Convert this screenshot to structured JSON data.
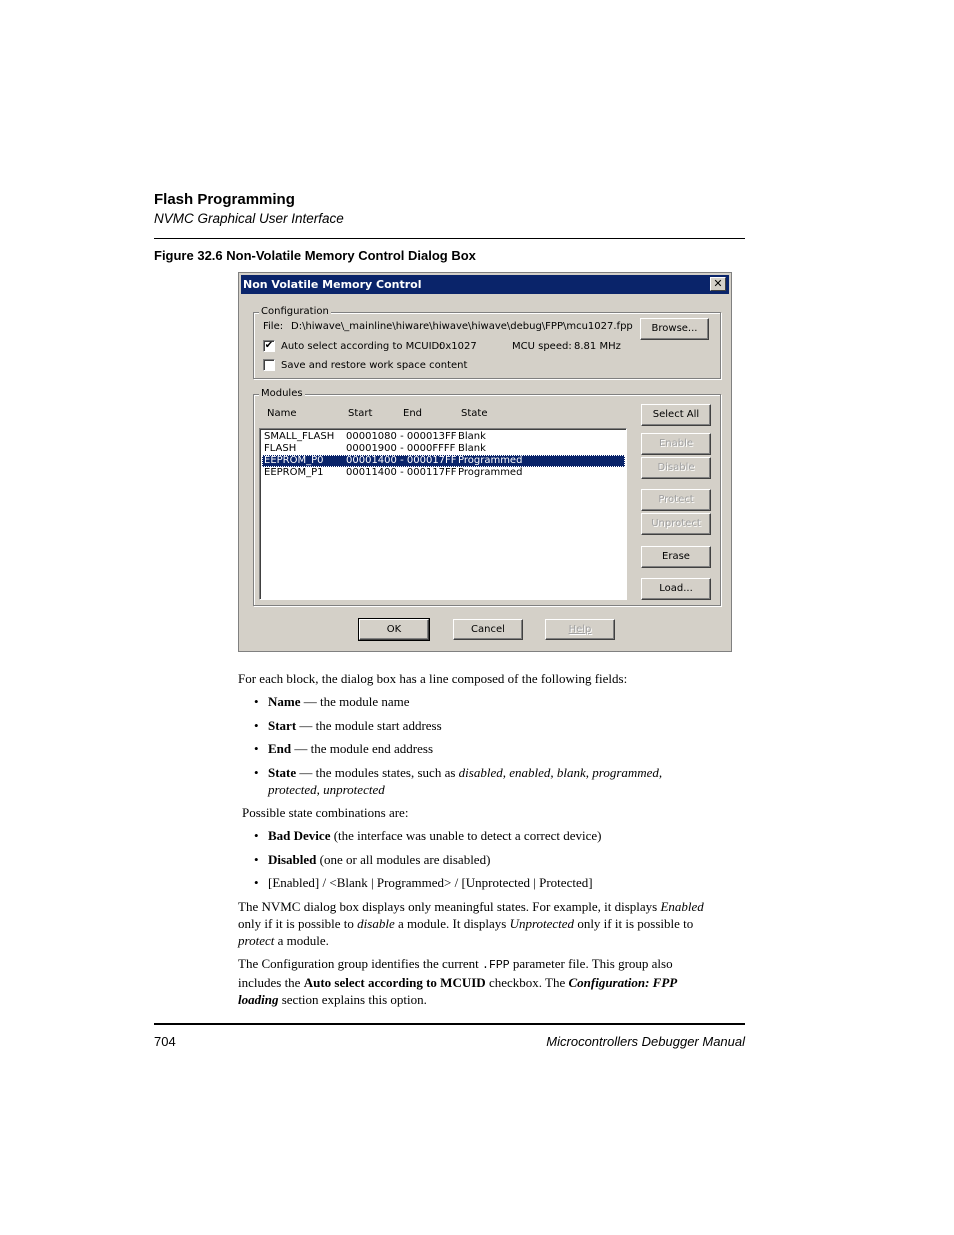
{
  "header": {
    "title": "Flash Programming",
    "subtitle": "NVMC Graphical User Interface"
  },
  "figure": {
    "caption": "Figure 32.6  Non-Volatile Memory Control Dialog Box"
  },
  "dialog": {
    "title": "Non Volatile Memory Control",
    "close_icon": "close-icon",
    "configuration": {
      "label": "Configuration",
      "file_label": "File:",
      "file_path": "D:\\hiwave\\_mainline\\hiware\\hiwave\\hiwave\\debug\\FPP\\mcu1027.fpp",
      "browse_label": "Browse...",
      "auto_select_label": "Auto select according to MCUID:",
      "auto_select_checked": true,
      "mcuid_value": "0x1027",
      "mcu_speed_label": "MCU speed:",
      "mcu_speed_value": "8.81 MHz",
      "save_restore_label": "Save and restore work space content",
      "save_restore_checked": false
    },
    "modules": {
      "label": "Modules",
      "columns": [
        "Name",
        "Start",
        "End",
        "State"
      ],
      "rows": [
        {
          "name": "SMALL_FLASH",
          "range": "00001080 - 000013FF",
          "state": "Blank",
          "selected": false
        },
        {
          "name": "FLASH",
          "range": "00001900 - 0000FFFF",
          "state": "Blank",
          "selected": false
        },
        {
          "name": "EEPROM_P0",
          "range": "00001400 - 000017FF",
          "state": "Programmed",
          "selected": true
        },
        {
          "name": "EEPROM_P1",
          "range": "00011400 - 000117FF",
          "state": "Programmed",
          "selected": false
        }
      ],
      "buttons": {
        "select_all": "Select All",
        "enable": "Enable",
        "disable": "Disable",
        "protect": "Protect",
        "unprotect": "Unprotect",
        "erase": "Erase",
        "load": "Load..."
      }
    },
    "footer_buttons": {
      "ok": "OK",
      "cancel": "Cancel",
      "help": "Help"
    }
  },
  "body": {
    "intro": "For each block, the dialog box has a line composed of the following fields:",
    "fields": [
      {
        "term": "Name",
        "desc": " — the module name"
      },
      {
        "term": "Start",
        "desc": " — the module start address"
      },
      {
        "term": "End",
        "desc": " — the module end address"
      },
      {
        "term": "State",
        "desc": " — the modules states, such as ",
        "italic": "disabled, enabled, blank, programmed,",
        "italic2": "protected, unprotected"
      }
    ],
    "combos_intro": "Possible state combinations are:",
    "combos": [
      {
        "term": "Bad Device",
        "desc": " (the interface was unable to detect a correct device)"
      },
      {
        "term": "Disabled",
        "desc": " (one or all modules are disabled)"
      },
      {
        "term": "",
        "desc": "[Enabled] / <Blank | Programmed> / [Unprotected | Protected]"
      }
    ],
    "para1": {
      "a": "The NVMC dialog box displays only meaningful states. For example, it displays ",
      "b": "Enabled",
      "c": "only if it is possible to ",
      "d": "disable",
      "e": " a module. It displays ",
      "f": "Unprotected",
      "g": " only if it is possible to",
      "h": "protect",
      "i": " a module."
    },
    "para2": {
      "a": "The Configuration group identifies the current ",
      "code": ".FPP",
      "b": " parameter file. This group also",
      "c": "includes the ",
      "d": "Auto select according to MCUID",
      "e": " checkbox. The ",
      "f": "Configuration: FPP",
      "g": "loading",
      "h": " section explains this option."
    }
  },
  "footer": {
    "page_number": "704",
    "manual_title": "Microcontrollers Debugger Manual"
  }
}
